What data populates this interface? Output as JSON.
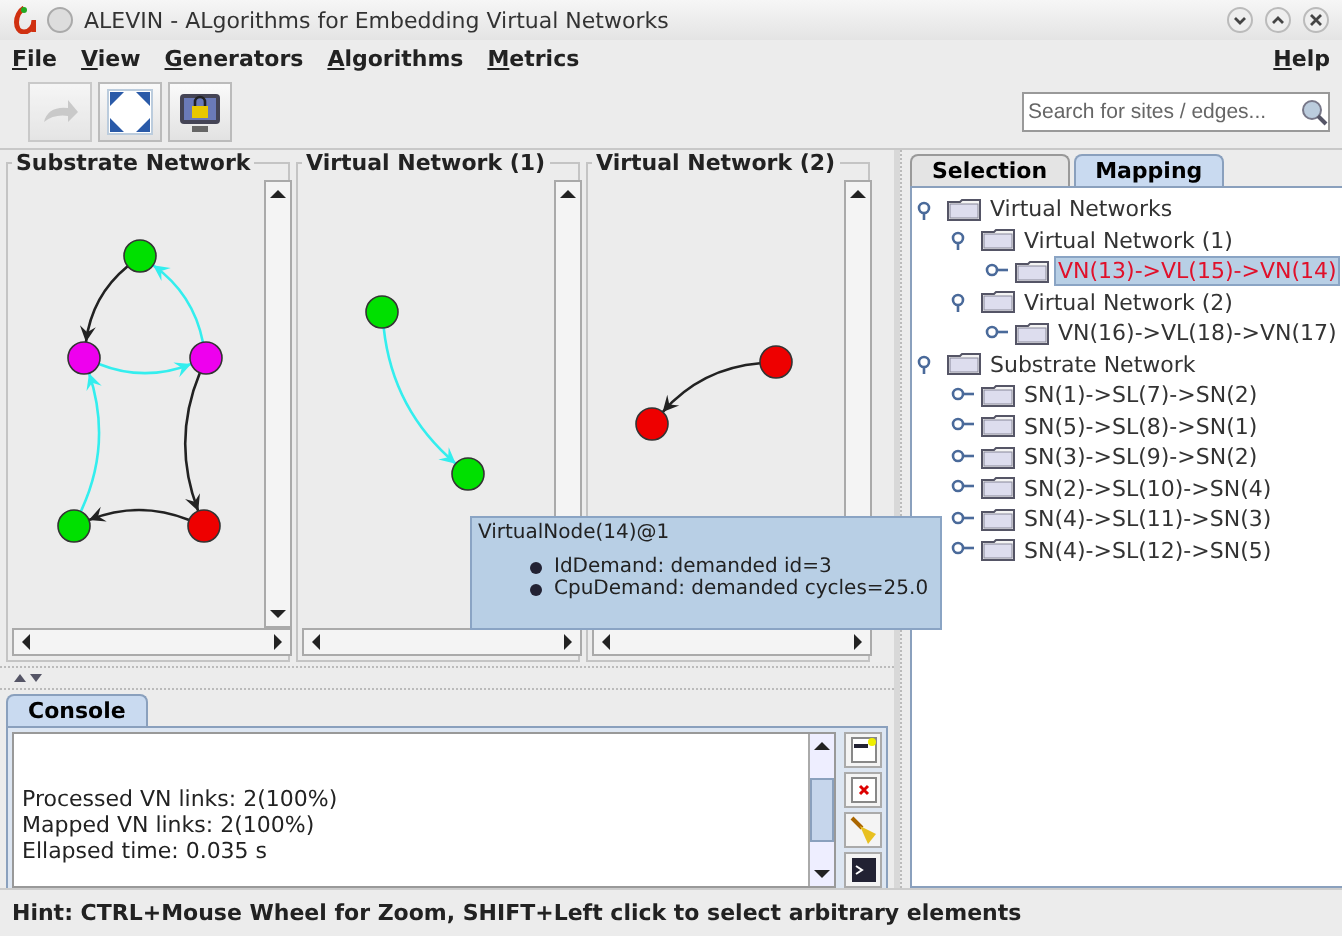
{
  "window": {
    "title": "ALEVIN - ALgorithms for Embedding Virtual Networks"
  },
  "menu": [
    {
      "label": "File"
    },
    {
      "label": "View"
    },
    {
      "label": "Generators"
    },
    {
      "label": "Algorithms"
    },
    {
      "label": "Metrics"
    }
  ],
  "help_menu": {
    "label": "Help"
  },
  "toolbar": {
    "buttons": [
      {
        "kind": "redo",
        "disabled": true
      },
      {
        "kind": "fit",
        "disabled": false
      },
      {
        "kind": "lock",
        "disabled": false
      }
    ],
    "search": {
      "placeholder": "Search for sites / edges..."
    }
  },
  "graph_panels": [
    {
      "title": "Substrate Network",
      "nodes": [
        {
          "color": "#00e000"
        },
        {
          "color": "#ee00ee"
        },
        {
          "color": "#ee00ee"
        },
        {
          "color": "#00e000"
        },
        {
          "color": "#ee0000"
        }
      ],
      "edges": [
        {
          "color": "#222222"
        },
        {
          "color": "#33eeee"
        },
        {
          "color": "#33eeee"
        },
        {
          "color": "#33eeee"
        },
        {
          "color": "#222222"
        },
        {
          "color": "#222222"
        }
      ]
    },
    {
      "title": "Virtual Network (1)",
      "nodes": [
        {
          "color": "#00e000"
        },
        {
          "color": "#00e000"
        }
      ],
      "edges": [
        {
          "color": "#33eeee"
        }
      ]
    },
    {
      "title": "Virtual Network (2)",
      "nodes": [
        {
          "color": "#ee0000"
        },
        {
          "color": "#ee0000"
        }
      ],
      "edges": [
        {
          "color": "#222222"
        }
      ]
    }
  ],
  "tooltip": {
    "title": "VirtualNode(14)@1",
    "items": [
      "IdDemand: demanded id=3",
      "CpuDemand: demanded cycles=25.0"
    ]
  },
  "side_tabs": [
    {
      "label": "Selection",
      "selected": false
    },
    {
      "label": "Mapping",
      "selected": true
    }
  ],
  "mapping_tree": [
    {
      "label": "Virtual Networks",
      "expanded": true,
      "selected": false,
      "children": [
        {
          "label": "Virtual Network (1)",
          "expanded": true,
          "selected": false,
          "children": [
            {
              "label": "VN(13)->VL(15)->VN(14)",
              "expanded": false,
              "selected": true
            }
          ]
        },
        {
          "label": "Virtual Network (2)",
          "expanded": true,
          "selected": false,
          "children": [
            {
              "label": "VN(16)->VL(18)->VN(17)",
              "expanded": false,
              "selected": false
            }
          ]
        }
      ]
    },
    {
      "label": "Substrate Network",
      "expanded": true,
      "selected": false,
      "children": [
        {
          "label": "SN(1)->SL(7)->SN(2)",
          "expanded": false,
          "selected": false
        },
        {
          "label": "SN(5)->SL(8)->SN(1)",
          "expanded": false,
          "selected": false
        },
        {
          "label": "SN(3)->SL(9)->SN(2)",
          "expanded": false,
          "selected": false
        },
        {
          "label": "SN(2)->SL(10)->SN(4)",
          "expanded": false,
          "selected": false
        },
        {
          "label": "SN(4)->SL(11)->SN(3)",
          "expanded": false,
          "selected": false
        },
        {
          "label": "SN(4)->SL(12)->SN(5)",
          "expanded": false,
          "selected": false
        }
      ]
    }
  ],
  "console": {
    "tabs": [
      {
        "label": "Console",
        "selected": true
      }
    ],
    "lines": [
      "Processed VN links: 2(100%)",
      "Mapped VN links: 2(100%)",
      "Ellapsed time: 0.035 s"
    ],
    "tools": [
      {
        "kind": "new"
      },
      {
        "kind": "clear"
      },
      {
        "kind": "broom"
      },
      {
        "kind": "terminal"
      }
    ]
  },
  "status_bar": {
    "hint": "Hint: CTRL+Mouse Wheel for Zoom, SHIFT+Left click to select arbitrary elements"
  }
}
